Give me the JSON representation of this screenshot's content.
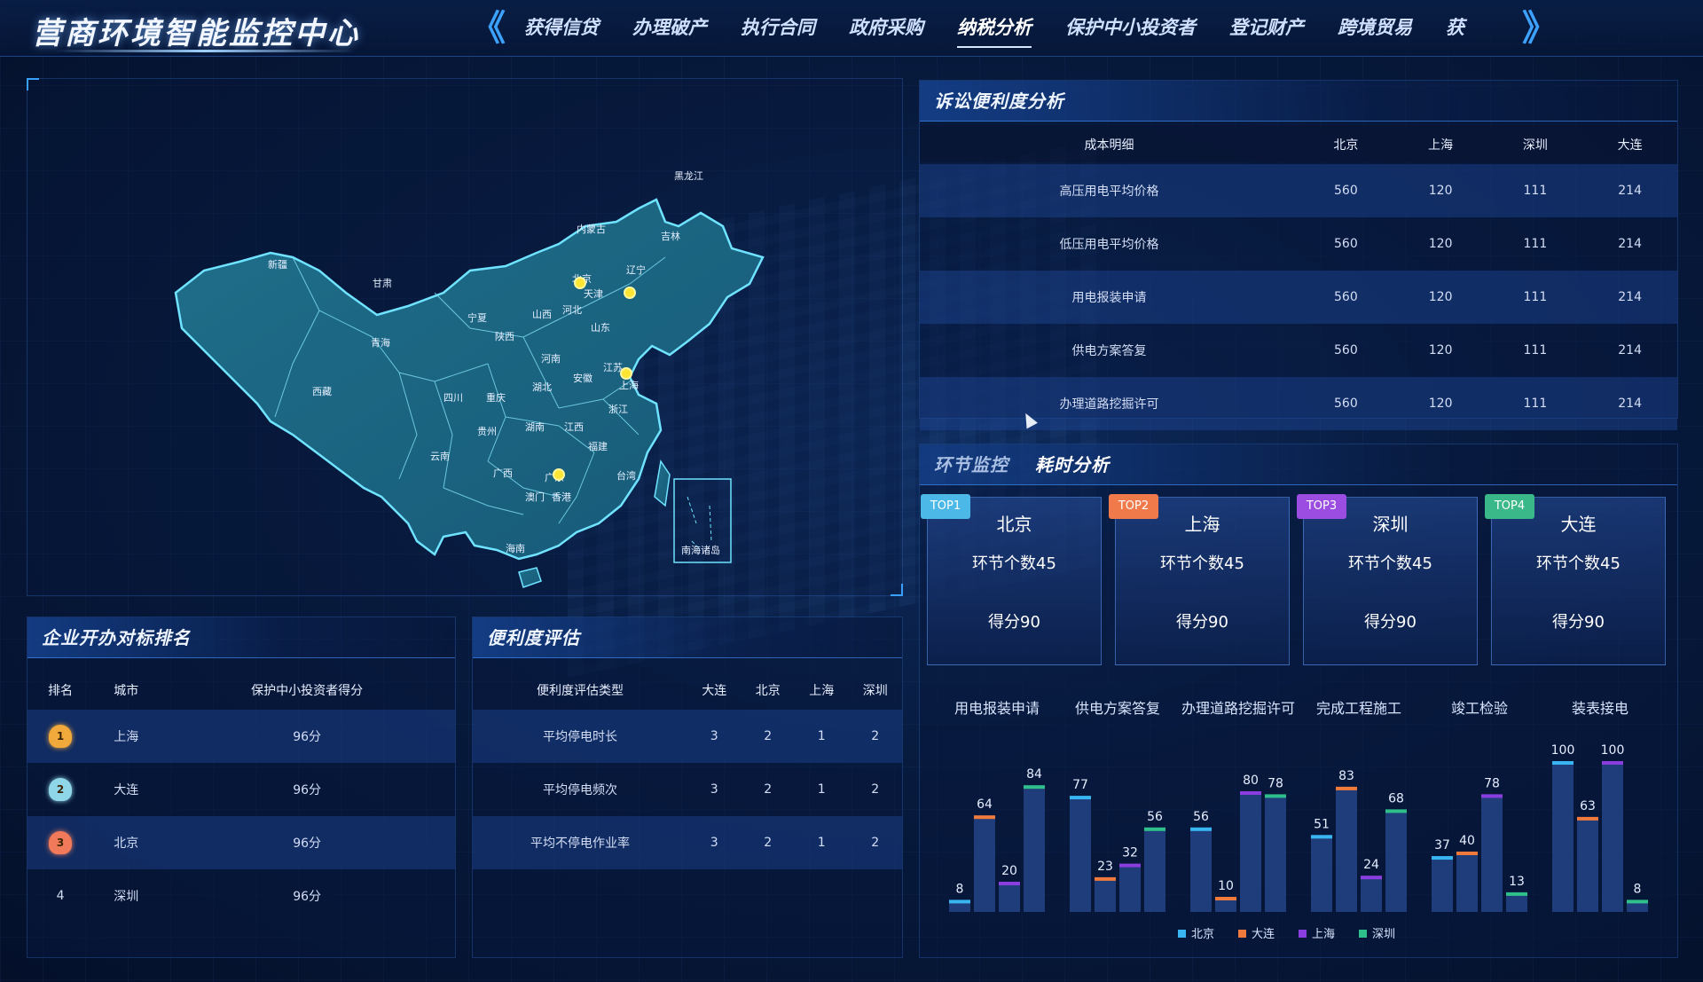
{
  "header": {
    "title": "营商环境智能监控中心",
    "left_arrow": "《",
    "right_arrow": "》",
    "tabs": [
      {
        "label": "获得信贷"
      },
      {
        "label": "办理破产"
      },
      {
        "label": "执行合同"
      },
      {
        "label": "政府采购"
      },
      {
        "label": "纳税分析",
        "active": true
      },
      {
        "label": "保护中小投资者"
      },
      {
        "label": "登记财产"
      },
      {
        "label": "跨境贸易"
      },
      {
        "label": "获"
      }
    ]
  },
  "map": {
    "provinces": {
      "xinjiang": "新疆",
      "xizang": "西藏",
      "qinghai": "青海",
      "gansu": "甘肃",
      "neimenggu": "内蒙古",
      "heilongjiang": "黑龙江",
      "jilin": "吉林",
      "liaoning": "辽宁",
      "beijing": "北京",
      "tianjin": "天津",
      "hebei": "河北",
      "shanxi": "山西",
      "shandong": "山东",
      "ningxia": "宁夏",
      "shaanxi": "陕西",
      "henan": "河南",
      "jiangsu": "江苏",
      "anhui": "安徽",
      "shanghai": "上海",
      "hubei": "湖北",
      "zhejiang": "浙江",
      "sichuan": "四川",
      "chongqing": "重庆",
      "guizhou": "贵州",
      "hunan": "湖南",
      "jiangxi": "江西",
      "fujian": "福建",
      "yunnan": "云南",
      "guangxi": "广西",
      "guangdong": "广东",
      "aomen": "澳门",
      "xianggang": "香港",
      "taiwan": "台湾",
      "hainan": "海南"
    },
    "inset_label": "南海诸岛"
  },
  "litigation": {
    "title": "诉讼便利度分析",
    "columns": [
      "成本明细",
      "北京",
      "上海",
      "深圳",
      "大连"
    ],
    "rows": [
      [
        "高压用电平均价格",
        "560",
        "120",
        "111",
        "214"
      ],
      [
        "低压用电平均价格",
        "560",
        "120",
        "111",
        "214"
      ],
      [
        "用电报装申请",
        "560",
        "120",
        "111",
        "214"
      ],
      [
        "供电方案答复",
        "560",
        "120",
        "111",
        "214"
      ],
      [
        "办理道路挖掘许可",
        "560",
        "120",
        "111",
        "214"
      ]
    ]
  },
  "monitor": {
    "tab_inactive": "环节监控",
    "tab_active": "耗时分析",
    "cards": [
      {
        "badge": "TOP1",
        "badge_color": "#4cb8e8",
        "city": "北京",
        "count": "环节个数45",
        "score": "得分90"
      },
      {
        "badge": "TOP2",
        "badge_color": "#f07a4a",
        "city": "上海",
        "count": "环节个数45",
        "score": "得分90"
      },
      {
        "badge": "TOP3",
        "badge_color": "#9a4de0",
        "city": "深圳",
        "count": "环节个数45",
        "score": "得分90"
      },
      {
        "badge": "TOP4",
        "badge_color": "#3ab88a",
        "city": "大连",
        "count": "环节个数45",
        "score": "得分90"
      }
    ]
  },
  "chart_data": {
    "type": "bar",
    "categories": [
      "用电报装申请",
      "供电方案答复",
      "办理道路挖掘许可",
      "完成工程施工",
      "竣工检验",
      "装表接电"
    ],
    "series": [
      {
        "name": "北京",
        "color": "#39b6f2",
        "values": [
          8,
          77,
          56,
          51,
          37,
          100
        ]
      },
      {
        "name": "大连",
        "color": "#f07a3c",
        "values": [
          64,
          23,
          10,
          83,
          40,
          63
        ]
      },
      {
        "name": "上海",
        "color": "#8a3ee0",
        "values": [
          20,
          32,
          80,
          24,
          78,
          100
        ]
      },
      {
        "name": "深圳",
        "color": "#2fbf8a",
        "values": [
          84,
          56,
          78,
          68,
          13,
          8
        ]
      }
    ],
    "ylim": [
      0,
      100
    ]
  },
  "ranking": {
    "title": "企业开办对标排名",
    "columns": [
      "排名",
      "城市",
      "保护中小投资者得分"
    ],
    "rows": [
      {
        "rank": "1",
        "city": "上海",
        "score": "96分",
        "medal_color": "#f2a93b"
      },
      {
        "rank": "2",
        "city": "大连",
        "score": "96分",
        "medal_color": "#8fd6e8"
      },
      {
        "rank": "3",
        "city": "北京",
        "score": "96分",
        "medal_color": "#f07a5a"
      },
      {
        "rank": "4",
        "city": "深圳",
        "score": "96分",
        "medal_color": ""
      }
    ]
  },
  "convenience": {
    "title": "便利度评估",
    "columns": [
      "便利度评估类型",
      "大连",
      "北京",
      "上海",
      "深圳"
    ],
    "rows": [
      [
        "平均停电时长",
        "3",
        "2",
        "1",
        "2"
      ],
      [
        "平均停电频次",
        "3",
        "2",
        "1",
        "2"
      ],
      [
        "平均不停电作业率",
        "3",
        "2",
        "1",
        "2"
      ]
    ]
  }
}
